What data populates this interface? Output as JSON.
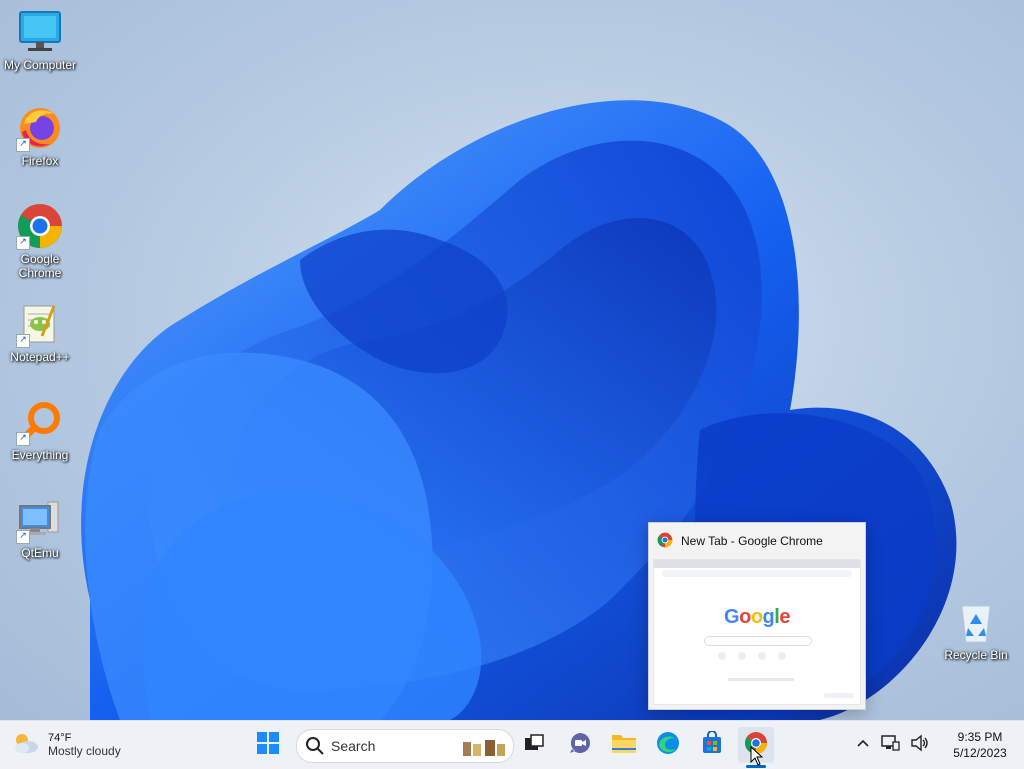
{
  "desktop": {
    "icons": [
      {
        "label": "My Computer",
        "icon": "monitor-icon",
        "shortcut": false
      },
      {
        "label": "Firefox",
        "icon": "firefox-icon",
        "shortcut": true
      },
      {
        "label": "Google Chrome",
        "icon": "chrome-icon",
        "shortcut": true
      },
      {
        "label": "Notepad++",
        "icon": "notepadpp-icon",
        "shortcut": true
      },
      {
        "label": "Everything",
        "icon": "everything-search-icon",
        "shortcut": true
      },
      {
        "label": "QtEmu",
        "icon": "qtemu-computer-icon",
        "shortcut": true
      },
      {
        "label": "Recycle Bin",
        "icon": "recycle-bin-icon",
        "shortcut": false
      }
    ]
  },
  "preview": {
    "title": "New Tab - Google Chrome",
    "thumbnail_logo": "Google"
  },
  "taskbar": {
    "weather": {
      "temp": "74°F",
      "condition": "Mostly cloudy",
      "icon": "partly-cloudy-icon"
    },
    "search_placeholder": "Search",
    "pinned": [
      "start-icon",
      "search-icon",
      "task-view-icon",
      "teams-chat-icon",
      "file-explorer-icon",
      "edge-icon",
      "store-icon",
      "chrome-icon"
    ],
    "active_app": "Google Chrome",
    "tray": {
      "icons": [
        "chevron-up-icon",
        "network-icon",
        "volume-icon"
      ]
    },
    "clock": {
      "time": "9:35 PM",
      "date": "5/12/2023"
    }
  },
  "colors": {
    "accent": "#0067c0",
    "wallpaper_bloom": "#1a6ef5",
    "taskbar_bg": "#eef1f6"
  }
}
